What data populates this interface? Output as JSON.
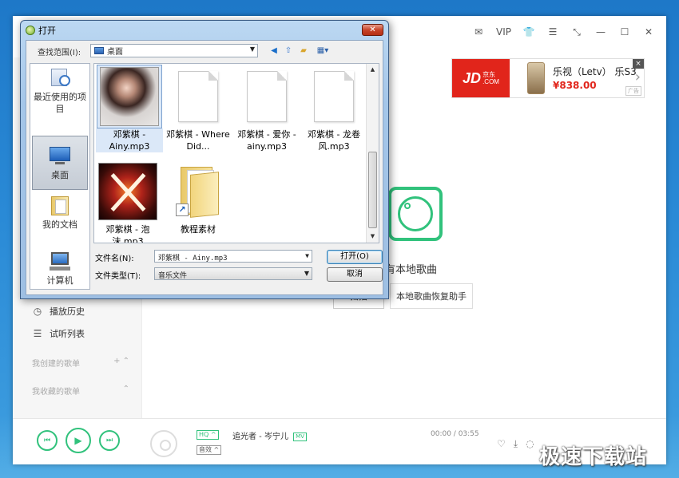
{
  "app": {
    "top_icons": {
      "vip_label": "VIP"
    },
    "ad": {
      "logo_text": "JD",
      "logo_sub": "京东\n.COM",
      "title": "乐视（Letv） 乐S3",
      "price": "¥838.00",
      "close": "×",
      "next": "›",
      "flag": "广告"
    },
    "empty_state": {
      "text": "有本地歌曲",
      "scan_label": "扫描",
      "repair_label": "本地歌曲恢复助手"
    },
    "sidebar": {
      "items": [
        {
          "label": "播放历史",
          "icon": "clock-icon",
          "glyph": "◷"
        },
        {
          "label": "试听列表",
          "icon": "list-icon",
          "glyph": "☰"
        }
      ],
      "groups": [
        {
          "label": "我创建的歌单",
          "actions": "+  ⌃"
        },
        {
          "label": "我收藏的歌单",
          "actions": "⌃"
        }
      ]
    },
    "player": {
      "hq": "HQ ^",
      "quality": "音效 ^",
      "song": "追光者 - 岑宁儿",
      "mv": "MV",
      "time": "00:00 / 03:55"
    }
  },
  "dialog": {
    "title": "打开",
    "close": "✕",
    "lookin_label": "查找范围(I):",
    "lookin_value": "桌面",
    "places": [
      {
        "label": "最近使用的项目",
        "icon": "recent-items-icon"
      },
      {
        "label": "桌面",
        "icon": "desktop-icon",
        "selected": true
      },
      {
        "label": "我的文档",
        "icon": "documents-icon"
      },
      {
        "label": "计算机",
        "icon": "computer-icon"
      }
    ],
    "files": [
      {
        "name": "邓紫棋 - Ainy.mp3",
        "kind": "photo1",
        "selected": true
      },
      {
        "name": "邓紫棋 - Where Did...",
        "kind": "doc"
      },
      {
        "name": "邓紫棋 - 爱你 - ainy.mp3",
        "kind": "doc"
      },
      {
        "name": "邓紫棋 - 龙卷风.mp3",
        "kind": "doc"
      },
      {
        "name": "邓紫棋 - 泡沫.mp3",
        "kind": "photo2"
      },
      {
        "name": "教程素材",
        "kind": "folder"
      }
    ],
    "filename_label": "文件名(N):",
    "filename_value": "邓紫棋 - Ainy.mp3",
    "filetype_label": "文件类型(T):",
    "filetype_value": "音乐文件",
    "open_label": "打开(O)",
    "cancel_label": "取消"
  },
  "watermark": "极速下载站",
  "colors": {
    "accent_green": "#31c27c",
    "jd_red": "#e1251b"
  }
}
